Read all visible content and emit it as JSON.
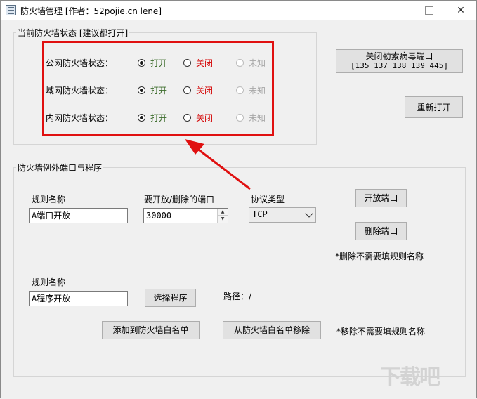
{
  "window": {
    "title": "防火墙管理 [作者：52pojie.cn lene]",
    "minimize_glyph": "—",
    "close_glyph": "✕"
  },
  "status_group": {
    "label": "当前防火墙状态 [建议都打开]",
    "rows": [
      {
        "label": "公网防火墙状态：",
        "open": "打开",
        "closed": "关闭",
        "unknown": "未知",
        "selected": "open"
      },
      {
        "label": "域网防火墙状态：",
        "open": "打开",
        "closed": "关闭",
        "unknown": "未知",
        "selected": "open"
      },
      {
        "label": "内网防火墙状态：",
        "open": "打开",
        "closed": "关闭",
        "unknown": "未知",
        "selected": "open"
      }
    ]
  },
  "ransomware_button": {
    "line1": "关闭勒索病毒端口",
    "line2": "[135 137 138 139 445]"
  },
  "reopen_button": "重新打开",
  "exceptions_group": {
    "label": "防火墙例外端口与程序",
    "rule_name_label": "规则名称",
    "rule_name_value": "A端口开放",
    "port_label": "要开放/删除的端口",
    "port_value": "30000",
    "protocol_label": "协议类型",
    "protocol_value": "TCP",
    "open_port_button": "开放端口",
    "delete_port_button": "删除端口",
    "delete_note": "*删除不需要填规则名称",
    "program_rule_label": "规则名称",
    "program_rule_value": "A程序开放",
    "select_program_button": "选择程序",
    "path_label": "路径：/",
    "add_whitelist_button": "添加到防火墙白名单",
    "remove_whitelist_button": "从防火墙白名单移除",
    "remove_note": "*移除不需要填规则名称"
  },
  "watermark": "下载吧",
  "colors": {
    "highlight": "#e01010",
    "open_text": "#3b6b2a",
    "closed_text": "#d40000",
    "unknown_text": "#a8a8a8"
  }
}
